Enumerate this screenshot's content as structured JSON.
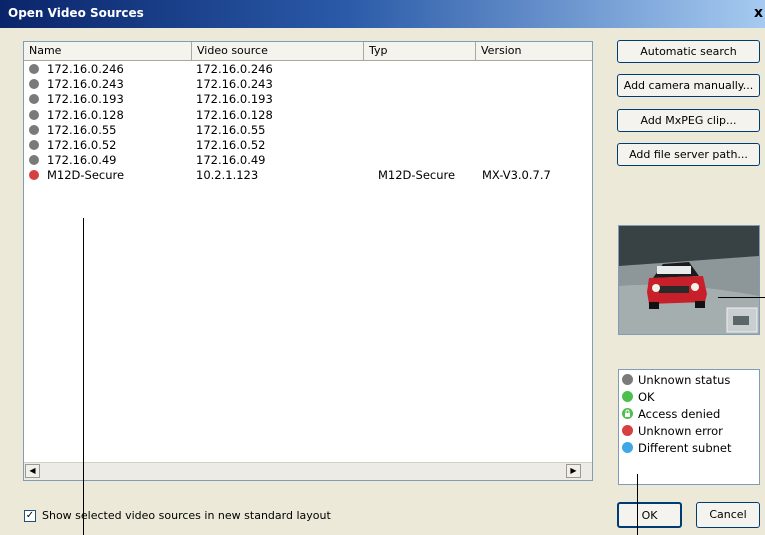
{
  "window": {
    "title": "Open Video Sources",
    "close_label": "x"
  },
  "table": {
    "columns": [
      "Name",
      "Video source",
      "Typ",
      "Version"
    ],
    "rows": [
      {
        "name": "172.16.0.246",
        "source": "172.16.0.246",
        "typ": "",
        "version": "",
        "status_color": "#7a7a7a"
      },
      {
        "name": "172.16.0.243",
        "source": "172.16.0.243",
        "typ": "",
        "version": "",
        "status_color": "#7a7a7a"
      },
      {
        "name": "172.16.0.193",
        "source": "172.16.0.193",
        "typ": "",
        "version": "",
        "status_color": "#7a7a7a"
      },
      {
        "name": "172.16.0.128",
        "source": "172.16.0.128",
        "typ": "",
        "version": "",
        "status_color": "#7a7a7a"
      },
      {
        "name": "172.16.0.55",
        "source": "172.16.0.55",
        "typ": "",
        "version": "",
        "status_color": "#7a7a7a"
      },
      {
        "name": "172.16.0.52",
        "source": "172.16.0.52",
        "typ": "",
        "version": "",
        "status_color": "#7a7a7a"
      },
      {
        "name": "172.16.0.49",
        "source": "172.16.0.49",
        "typ": "",
        "version": "",
        "status_color": "#7a7a7a"
      },
      {
        "name": "M12D-Secure",
        "source": "10.2.1.123",
        "typ": "M12D-Secure",
        "version": "MX-V3.0.7.7",
        "status_color": "#d64040"
      }
    ]
  },
  "buttons": {
    "automatic_search": "Automatic search",
    "add_camera": "Add camera manually...",
    "add_mxpeg": "Add MxPEG clip...",
    "add_file_server": "Add file server path...",
    "ok": "OK",
    "cancel": "Cancel"
  },
  "legend": [
    {
      "label": "Unknown status",
      "color": "#7a7a7a",
      "icon": "status-dot"
    },
    {
      "label": "OK",
      "color": "#4cbf4c",
      "icon": "status-dot"
    },
    {
      "label": "Access denied",
      "color": "#4cbf4c",
      "icon": "lock-icon"
    },
    {
      "label": "Unknown error",
      "color": "#d64040",
      "icon": "status-dot"
    },
    {
      "label": "Different subnet",
      "color": "#3fa7e6",
      "icon": "status-dot"
    }
  ],
  "checkbox": {
    "label": "Show selected video sources in new standard layout",
    "checked": true
  }
}
